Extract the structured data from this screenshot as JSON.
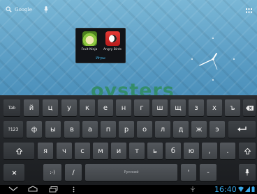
{
  "top_bar": {
    "search_label": "Google",
    "icons": [
      "search-icon",
      "microphone-icon",
      "all-apps-icon"
    ]
  },
  "folder": {
    "name": "Игры",
    "apps": [
      {
        "label": "Fruit Ninja",
        "icon": "fruit-ninja-icon"
      },
      {
        "label": "Angry Birds",
        "icon": "angry-birds-icon"
      }
    ]
  },
  "watermark": "oysters",
  "keyboard": {
    "row1": [
      "Tab",
      "й",
      "ц",
      "у",
      "к",
      "е",
      "н",
      "г",
      "ш",
      "щ",
      "з",
      "х",
      "ъ"
    ],
    "row2": [
      "?123",
      "ф",
      "ы",
      "в",
      "а",
      "п",
      "р",
      "о",
      "л",
      "д",
      "ж",
      "э"
    ],
    "row3": [
      "я",
      "ч",
      "с",
      "м",
      "и",
      "т",
      "ь",
      "б",
      "ю",
      ",",
      "."
    ],
    "row4": {
      "smiley": ":-)",
      "slash": "/",
      "space": "Русский",
      "apostrophe": "'",
      "dash": "-"
    },
    "icons": [
      "backspace-icon",
      "enter-icon",
      "shift-icon",
      "settings-icon",
      "microphone-icon"
    ]
  },
  "status_bar": {
    "time": "16:40",
    "icons": [
      "back-icon",
      "home-icon",
      "recent-apps-icon",
      "menu-icon",
      "usb-icon",
      "wifi-icon",
      "signal-icon",
      "battery-icon"
    ]
  },
  "colors": {
    "accent": "#3aa7e6",
    "watermark": "#2a8c4f"
  }
}
